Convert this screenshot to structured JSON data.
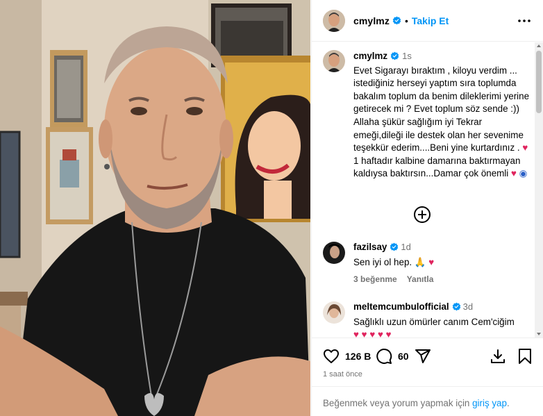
{
  "post": {
    "username": "cmylmz",
    "follow_label": "Takip Et",
    "more_label": "•••"
  },
  "caption": {
    "username": "cmylmz",
    "time": "1s",
    "text": "Evet Sigarayı bıraktım , kiloyu verdim ... istediğiniz herseyi yaptım sıra toplumda bakalım toplum da benim dileklerimi yerine getirecek mi ? Evet toplum söz sende :)) Allaha şükür sağlığım iyi Tekrar emeği,dileği ile destek olan  her sevenime teşekkür ederim....Beni yine kurtardınız .",
    "text2": " 1 haftadır kalbine damarına baktırmayan kaldıysa baktırsın...Damar çok önemli "
  },
  "comments": [
    {
      "username": "fazilsay",
      "time": "1d",
      "text": "Sen iyi ol hep. ",
      "likes": "3 beğenme",
      "reply": "Yanıtla"
    },
    {
      "username": "meltemcumbulofficial",
      "time": "3d",
      "text": "Sağlıklı uzun ömürler canım Cem'ciğim"
    }
  ],
  "actions": {
    "like_count": "126 B",
    "comment_count": "60"
  },
  "posted_ago": "1 saat önce",
  "login_prompt": {
    "text": "Beğenmek veya yorum yapmak için ",
    "link": "giriş yap",
    "suffix": "."
  },
  "colors": {
    "accent": "#0095f6",
    "muted": "#737373",
    "heart": "#e0245e"
  },
  "icons": [
    "heart-icon",
    "comment-icon",
    "share-icon",
    "save-icon",
    "download-icon",
    "add-icon",
    "verified-icon",
    "more-icon"
  ]
}
